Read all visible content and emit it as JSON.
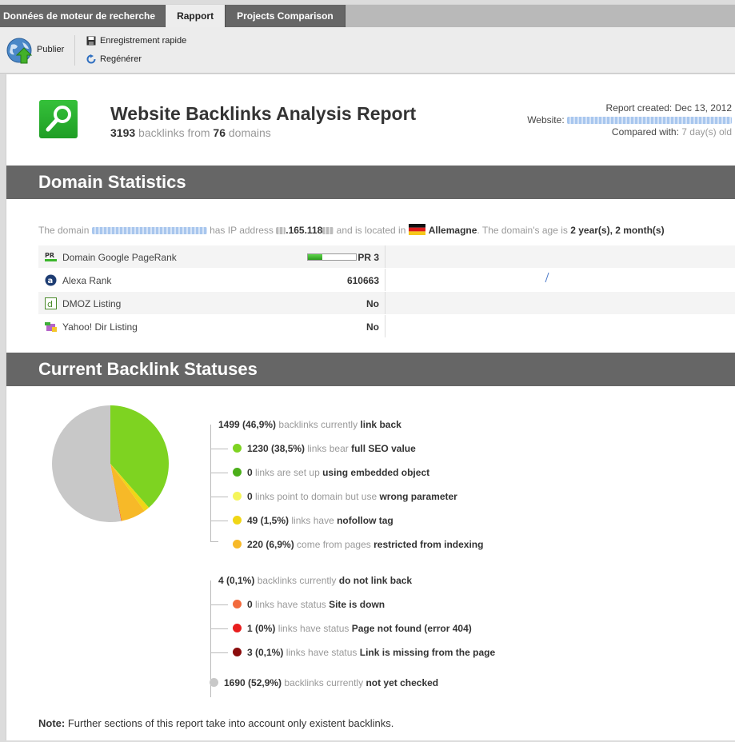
{
  "tabs": [
    {
      "label": "Données de moteur de recherche",
      "active": false
    },
    {
      "label": "Rapport",
      "active": true
    },
    {
      "label": "Projects Comparison",
      "active": false
    }
  ],
  "toolbar": {
    "publish_label": "Publier",
    "quick_save_label": "Enregistrement rapide",
    "regenerate_label": "Regénérer"
  },
  "report": {
    "title": "Website Backlinks Analysis Report",
    "backlinks_count": "3193",
    "backlinks_text": "backlinks from",
    "domains_count": "76",
    "domains_text": "domains",
    "created_label": "Report created:",
    "created_value": "Dec 13, 2012",
    "website_label": "Website:",
    "compared_label": "Compared with:",
    "compared_value": "7 day(s) old"
  },
  "domain_statistics": {
    "heading": "Domain Statistics",
    "t1": "The domain",
    "t2": "has IP address",
    "ip_visible": ".165.118",
    "t3": "and is located in",
    "country": "Allemagne",
    "t4": ". The domain's age is",
    "age": "2 year(s), 2 month(s)",
    "rows": [
      {
        "name": "Domain Google PageRank",
        "value": "PR 3",
        "pagerank_level": 0.3
      },
      {
        "name": "Alexa Rank",
        "value": "610663"
      },
      {
        "name": "DMOZ Listing",
        "value": "No"
      },
      {
        "name": "Yahoo! Dir Listing",
        "value": "No"
      }
    ]
  },
  "backlink_statuses": {
    "heading": "Current Backlink Statuses",
    "groups": [
      {
        "count": "1499 (46,9%)",
        "text": "backlinks currently",
        "status": "link back",
        "items": [
          {
            "count": "1230 (38,5%)",
            "text": "links bear",
            "status": "full SEO value",
            "color": "#7ed321"
          },
          {
            "count": "0",
            "text": "links are set up",
            "status": "using embedded object",
            "color": "#4caf1a"
          },
          {
            "count": "0",
            "text": "links point to domain but use",
            "status": "wrong parameter",
            "color": "#f5f55a"
          },
          {
            "count": "49 (1,5%)",
            "text": "links have",
            "status": "nofollow tag",
            "color": "#f0d616"
          },
          {
            "count": "220 (6,9%)",
            "text": "come from pages",
            "status": "restricted from indexing",
            "color": "#f7b928"
          }
        ]
      },
      {
        "count": "4 (0,1%)",
        "text": "backlinks currently",
        "status": "do not link back",
        "items": [
          {
            "count": "0",
            "text": "links have status",
            "status": "Site is down",
            "color": "#f26a3d"
          },
          {
            "count": "1 (0%)",
            "text": "links have status",
            "status": "Page not found (error 404)",
            "color": "#e81e1e"
          },
          {
            "count": "3 (0,1%)",
            "text": "links have status",
            "status": "Link is missing from the page",
            "color": "#8b0d0d"
          }
        ]
      }
    ],
    "unchecked": {
      "count": "1690 (52,9%)",
      "text": "backlinks currently",
      "status": "not yet checked",
      "color": "#c8c8c8"
    },
    "note_label": "Note:",
    "note_text": "Further sections of this report take into account only existent backlinks."
  },
  "chart_data": {
    "type": "pie",
    "categories": [
      "full SEO value",
      "nofollow tag",
      "restricted from indexing",
      "do not link back",
      "not yet checked"
    ],
    "values": [
      38.5,
      1.5,
      6.9,
      0.1,
      52.9
    ],
    "colors": [
      "#7ed321",
      "#f0d616",
      "#f7b928",
      "#e81e1e",
      "#c8c8c8"
    ]
  }
}
